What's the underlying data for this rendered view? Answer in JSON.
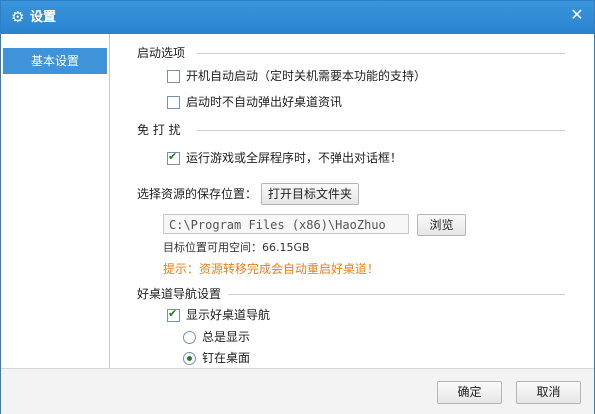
{
  "window": {
    "title": "设置",
    "title_icon": "gear-icon",
    "close_glyph": "✕"
  },
  "sidebar": {
    "items": [
      {
        "label": "基本设置",
        "selected": true
      }
    ]
  },
  "startup": {
    "title": "启动选项",
    "auto_start": {
      "label": "开机自动启动（定时关机需要本功能的支持）",
      "checked": false
    },
    "no_popup": {
      "label": "启动时不自动弹出好桌道资讯",
      "checked": false
    }
  },
  "dnd": {
    "title": "免 打 扰",
    "no_dialog": {
      "label": "运行游戏或全屏程序时，不弹出对话框！",
      "checked": true
    }
  },
  "storage": {
    "label": "选择资源的保存位置：",
    "open_folder_button": "打开目标文件夹",
    "path_value": "C:\\Program Files (x86)\\HaoZhuo",
    "browse_button": "浏览",
    "free_space": "目标位置可用空间：66.15GB",
    "hint": "提示：资源转移完成会自动重启好桌道！"
  },
  "nav": {
    "title": "好桌道导航设置",
    "show_nav": {
      "label": "显示好桌道导航",
      "checked": true
    },
    "always_show": {
      "label": "总是显示",
      "selected": false
    },
    "pin_desktop": {
      "label": "钉在桌面",
      "selected": true
    }
  },
  "footer": {
    "ok_button": "确定",
    "cancel_button": "取消"
  },
  "colors": {
    "titlebar": "#2a83cf",
    "sidebar_selected": "#3f93d8",
    "hint": "#e8801c"
  }
}
